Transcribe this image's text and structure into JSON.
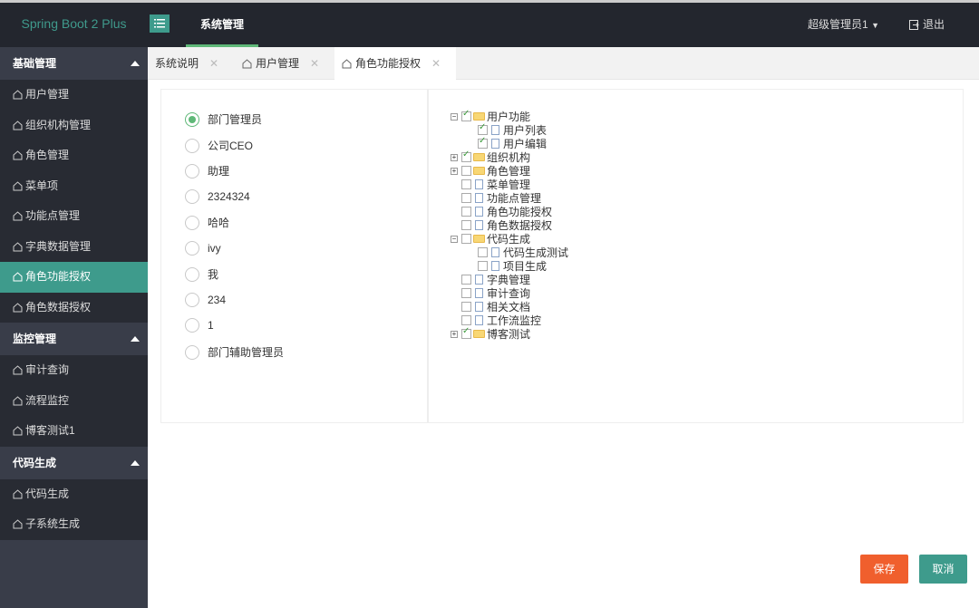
{
  "header": {
    "app_title": "Spring Boot 2 Plus",
    "nav_item": "系统管理",
    "user_name": "超级管理员1",
    "logout_label": "退出"
  },
  "sidebar": {
    "groups": [
      {
        "title": "基础管理",
        "items": [
          "用户管理",
          "组织机构管理",
          "角色管理",
          "菜单项",
          "功能点管理",
          "字典数据管理",
          "角色功能授权",
          "角色数据授权"
        ],
        "active": "角色功能授权"
      },
      {
        "title": "监控管理",
        "items": [
          "审计查询",
          "流程监控",
          "博客测试1"
        ]
      },
      {
        "title": "代码生成",
        "items": [
          "代码生成",
          "子系统生成"
        ]
      }
    ]
  },
  "tabs": [
    {
      "label": "系统说明",
      "has_icon": false
    },
    {
      "label": "用户管理",
      "has_icon": true
    },
    {
      "label": "角色功能授权",
      "has_icon": true,
      "active": true
    }
  ],
  "roles": {
    "selected": "部门管理员",
    "items": [
      "部门管理员",
      "公司CEO",
      "助理",
      "2324324",
      "哈哈",
      "ivy",
      "我",
      "234",
      "1",
      "部门辅助管理员"
    ]
  },
  "tree": [
    {
      "label": "用户功能",
      "level": 0,
      "type": "folder",
      "checked": true,
      "expander": "minus"
    },
    {
      "label": "用户列表",
      "level": 1,
      "type": "file",
      "checked": true
    },
    {
      "label": "用户编辑",
      "level": 1,
      "type": "file",
      "checked": true
    },
    {
      "label": "组织机构",
      "level": 0,
      "type": "folder",
      "checked": true,
      "expander": "plus"
    },
    {
      "label": "角色管理",
      "level": 0,
      "type": "folder",
      "checked": false,
      "expander": "plus"
    },
    {
      "label": "菜单管理",
      "level": 0,
      "type": "file",
      "checked": false
    },
    {
      "label": "功能点管理",
      "level": 0,
      "type": "file",
      "checked": false
    },
    {
      "label": "角色功能授权",
      "level": 0,
      "type": "file",
      "checked": false
    },
    {
      "label": "角色数据授权",
      "level": 0,
      "type": "file",
      "checked": false
    },
    {
      "label": "代码生成",
      "level": 0,
      "type": "folder",
      "checked": false,
      "expander": "minus"
    },
    {
      "label": "代码生成测试",
      "level": 1,
      "type": "file",
      "checked": false
    },
    {
      "label": "项目生成",
      "level": 1,
      "type": "file",
      "checked": false
    },
    {
      "label": "字典管理",
      "level": 0,
      "type": "file",
      "checked": false
    },
    {
      "label": "审计查询",
      "level": 0,
      "type": "file",
      "checked": false
    },
    {
      "label": "相关文档",
      "level": 0,
      "type": "file",
      "checked": false
    },
    {
      "label": "工作流监控",
      "level": 0,
      "type": "file",
      "checked": false
    },
    {
      "label": "博客测试",
      "level": 0,
      "type": "folder",
      "checked": true,
      "expander": "plus"
    }
  ],
  "buttons": {
    "save": "保存",
    "cancel": "取消"
  },
  "colors": {
    "accent": "#3e9b8c",
    "save": "#f05f2d",
    "sidebar_bg": "#393d49",
    "topbar_bg": "#23262e"
  }
}
